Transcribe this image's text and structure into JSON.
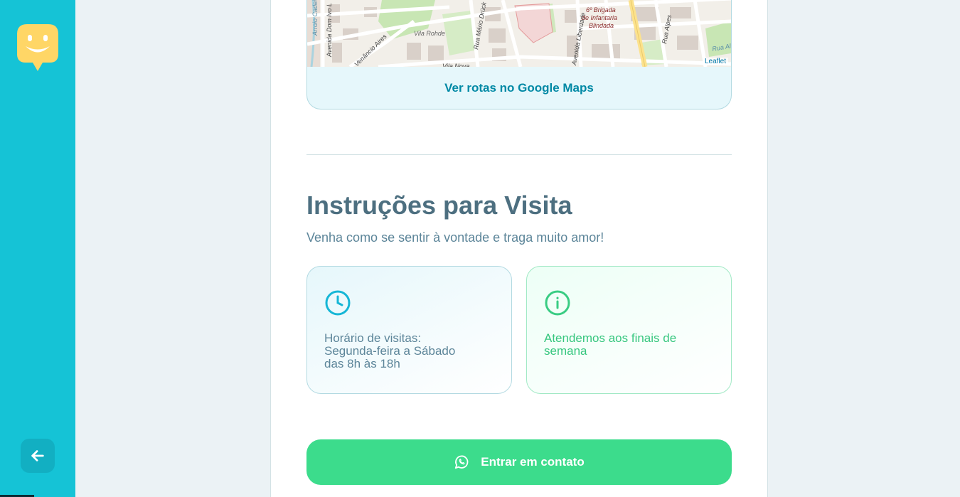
{
  "sidebar": {
    "logo_icon": "happy-face-logo-icon",
    "back_icon": "arrow-left-icon",
    "bg_color": "#15c3d6",
    "logo_color": "#ffd666"
  },
  "map": {
    "street_labels": [
      "Arroio Cadeia",
      "Avenida Dom Ivo L",
      "Venâncio Aires",
      "Vila Rohde",
      "Rua Mário Drück",
      "Avenida Liberdade",
      "6º Brigada de Infantaria Blindada",
      "Rua Alpes",
      "Vila Nova",
      "Rua Aldeia"
    ],
    "attribution": "Leaflet",
    "directions_link": "Ver rotas no Google Maps"
  },
  "instructions": {
    "title": "Instruções para Visita",
    "description": "Venha como se sentir à vontade e traga muito amor!",
    "hours": {
      "icon": "clock-icon",
      "text": "Horário de visitas:\nSegunda-feira a Sábado\ndas 8h às 18h"
    },
    "weekend": {
      "icon": "info-icon",
      "text": "Atendemos aos finais de\nsemana"
    }
  },
  "contact_button": {
    "icon": "whatsapp-icon",
    "label": "Entrar em contato",
    "color": "#3cdc8c"
  }
}
